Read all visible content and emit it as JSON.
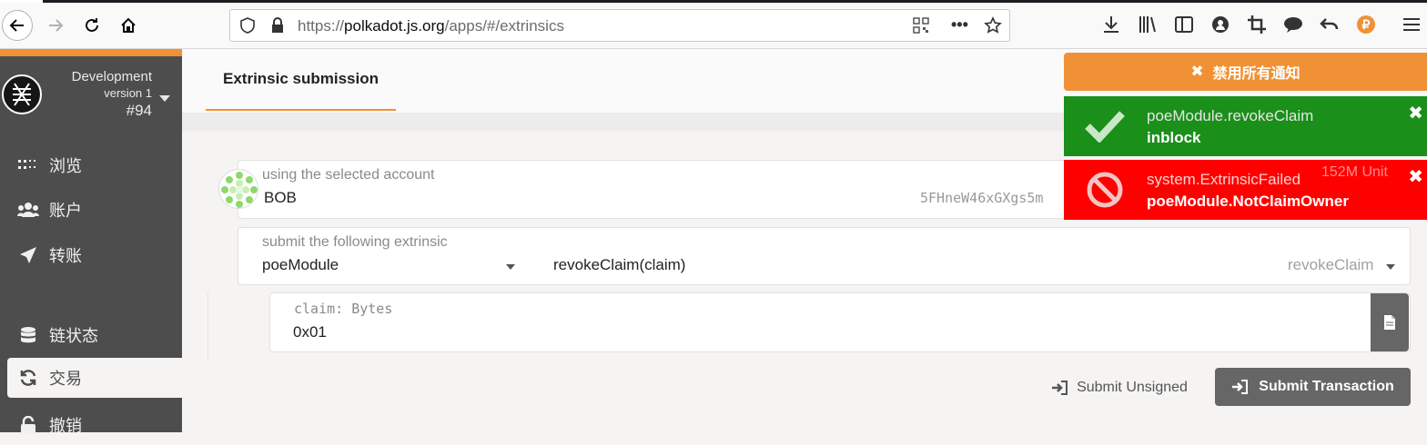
{
  "browser": {
    "url_prefix": "https://",
    "url_domain": "polkadot.js.org",
    "url_path": "/apps/#/extrinsics"
  },
  "sidebar": {
    "chain_name": "Development",
    "chain_version": "version 1",
    "block_number": "#94",
    "items": [
      {
        "label": "浏览",
        "icon": "explore-icon"
      },
      {
        "label": "账户",
        "icon": "users-icon"
      },
      {
        "label": "转账",
        "icon": "send-icon"
      },
      {
        "label": "链状态",
        "icon": "database-icon"
      },
      {
        "label": "交易",
        "icon": "sync-icon"
      },
      {
        "label": "撤销",
        "icon": "unlock-icon"
      }
    ],
    "active_index": 4
  },
  "header": {
    "tab_label": "Extrinsic submission"
  },
  "account": {
    "label": "using the selected account",
    "name": "BOB",
    "address": "5FHneW46xGXgs5m",
    "balance_partial": "152M Unit"
  },
  "extrinsic": {
    "label": "submit the following extrinsic",
    "module": "poeModule",
    "method": "revokeClaim(claim)",
    "method_hint": "revokeClaim"
  },
  "param": {
    "label": "claim: Bytes",
    "value": "0x01"
  },
  "actions": {
    "submit_unsigned": "Submit Unsigned",
    "submit_transaction": "Submit Transaction"
  },
  "notifications": {
    "disable_all": "禁用所有通知",
    "items": [
      {
        "title": "poeModule.revokeClaim",
        "status": "inblock",
        "color": "#1a8f1a",
        "icon": "check-icon"
      },
      {
        "title": "system.ExtrinsicFailed",
        "status": "poeModule.NotClaimOwner",
        "color": "#ff0000",
        "icon": "ban-icon"
      }
    ]
  },
  "colors": {
    "accent": "#f19135",
    "sidebar_bg": "#4d4d4d",
    "success": "#1a8f1a",
    "error": "#ff0000"
  }
}
